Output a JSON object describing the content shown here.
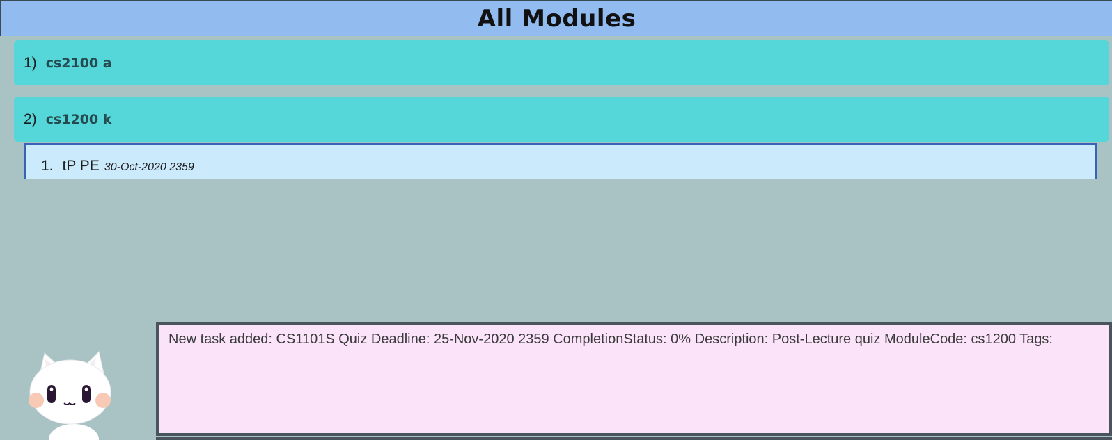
{
  "header": {
    "title": "All Modules"
  },
  "modules": [
    {
      "index": "1)",
      "name": "cs2100 a"
    },
    {
      "index": "2)",
      "name": "cs1200 k"
    }
  ],
  "tasks": [
    {
      "index": "1.",
      "name": "tP PE",
      "deadline": "30-Oct-2020 2359"
    }
  ],
  "result": {
    "message": "New task added: CS1101S Quiz Deadline: 25-Nov-2020 2359 CompletionStatus: 0% Description: Post-Lecture quiz ModuleCode: cs1200 Tags:"
  },
  "mascot": {
    "icon": "cat-mascot-icon"
  },
  "colors": {
    "header_bg": "#92bbf0",
    "module_card_bg": "#55d6d8",
    "task_panel_bg": "#cbeafb",
    "task_panel_border": "#3a62b8",
    "result_bg": "#fbe3fa",
    "app_bg": "#a9c3c4"
  }
}
